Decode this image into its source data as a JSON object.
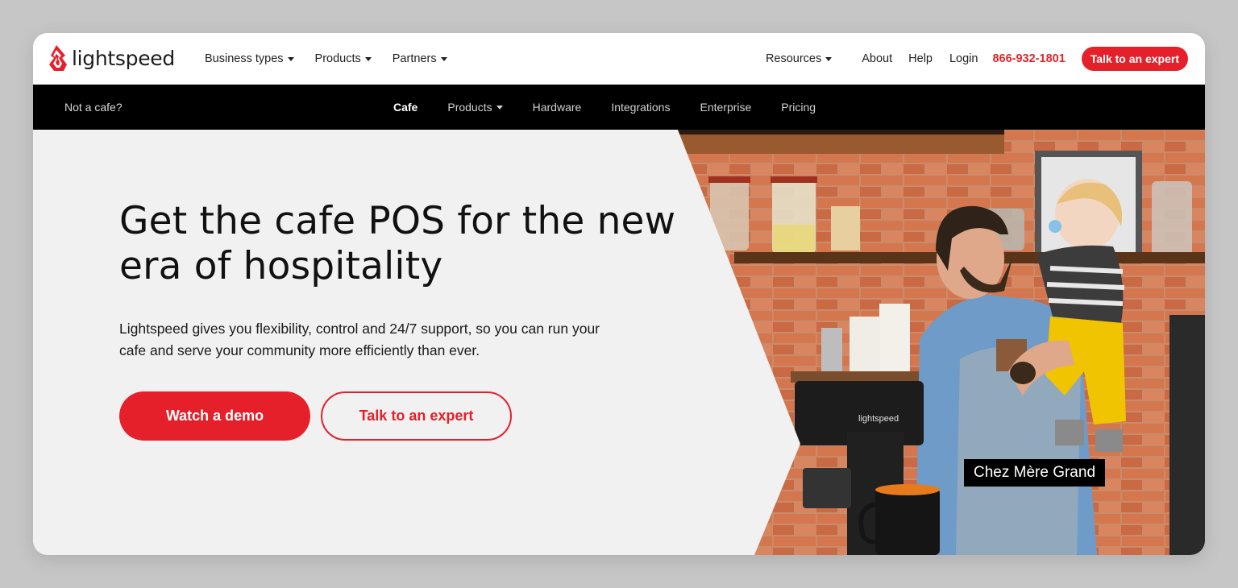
{
  "brand": {
    "name": "lightspeed",
    "accent": "#e5202a"
  },
  "topnav": {
    "left_items": [
      {
        "label": "Business types",
        "has_dropdown": true
      },
      {
        "label": "Products",
        "has_dropdown": true
      },
      {
        "label": "Partners",
        "has_dropdown": true
      }
    ],
    "resources": "Resources",
    "about": "About",
    "help": "Help",
    "login": "Login",
    "phone": "866-932-1801",
    "cta": "Talk to an expert"
  },
  "subnav": {
    "not_cafe": "Not a cafe?",
    "items": [
      {
        "label": "Cafe",
        "active": true
      },
      {
        "label": "Products",
        "has_dropdown": true
      },
      {
        "label": "Hardware"
      },
      {
        "label": "Integrations"
      },
      {
        "label": "Enterprise"
      },
      {
        "label": "Pricing"
      }
    ]
  },
  "hero": {
    "title": "Get the cafe POS for the new era of hospitality",
    "description": "Lightspeed gives you flexibility, control and 24/7 support, so you can run your cafe and serve your community more efficiently than ever.",
    "primary_button": "Watch a demo",
    "secondary_button": "Talk to an expert",
    "photo_caption": "Chez Mère Grand",
    "device_logo": "lightspeed"
  }
}
